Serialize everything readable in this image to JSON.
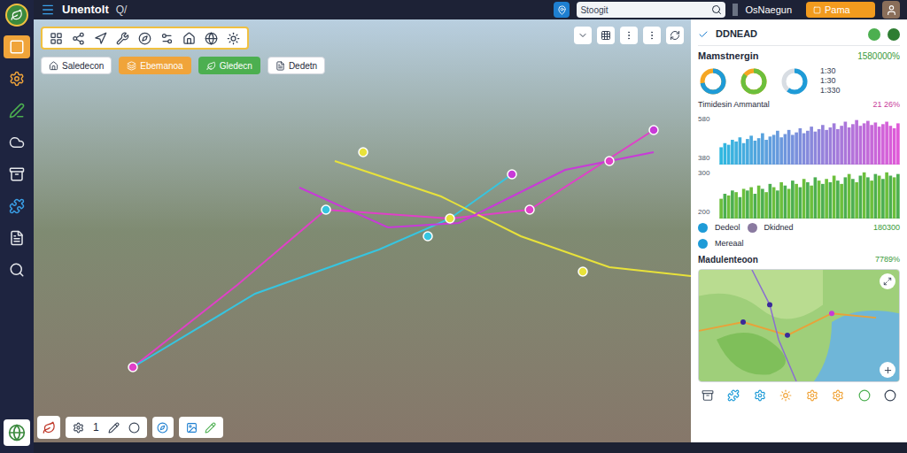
{
  "app": {
    "title": "Unentolt",
    "subtitle": "Q/"
  },
  "sidebar": {
    "items": [
      {
        "selected": true
      },
      {
        "selected": false
      },
      {
        "selected": false
      },
      {
        "selected": false
      },
      {
        "selected": false
      },
      {
        "selected": false
      },
      {
        "selected": false
      },
      {
        "selected": false
      }
    ]
  },
  "search": {
    "placeholder": "Stoogit"
  },
  "user": {
    "name": "OsNaegun"
  },
  "primary_button": {
    "label": "Pama"
  },
  "filters": [
    {
      "label": "Saledecon",
      "color": "#ffffff"
    },
    {
      "label": "Ebemanoa",
      "color": "#f0a43a"
    },
    {
      "label": "Gledecn",
      "color": "#4caf50"
    },
    {
      "label": "Dedetn",
      "color": "#ffffff"
    }
  ],
  "routes": [
    {
      "color": "#e040c8"
    },
    {
      "color": "#36c5e0"
    },
    {
      "color": "#e8e23a"
    },
    {
      "color": "#c83ad8"
    }
  ],
  "bottom_toolbar": {
    "page": "1"
  },
  "panel": {
    "title": "DDNEAD",
    "metric": {
      "label": "Mamstnergin",
      "value": "1580000%"
    },
    "donuts": [
      {
        "level": 0.72,
        "color": "#1e9bd7"
      },
      {
        "level": 0.85,
        "color": "#6cbf3c"
      },
      {
        "level": 0.6,
        "color": "#1e9bd7"
      }
    ],
    "readings": [
      "1:30",
      "1:30",
      "1:330"
    ],
    "chart1": {
      "title": "Timidesin Ammantal",
      "value": "21 26%",
      "ticks": [
        "580",
        "380"
      ],
      "max": 600,
      "values": [
        210,
        260,
        240,
        300,
        280,
        330,
        260,
        310,
        350,
        290,
        320,
        380,
        300,
        340,
        360,
        410,
        330,
        370,
        420,
        360,
        390,
        440,
        380,
        410,
        460,
        400,
        430,
        480,
        420,
        450,
        500,
        430,
        470,
        520,
        450,
        490,
        540,
        470,
        500,
        530,
        480,
        510,
        460,
        490,
        520,
        470,
        440,
        500
      ]
    },
    "chart2": {
      "ticks": [
        "300",
        "200"
      ],
      "max": 300,
      "values": [
        120,
        150,
        140,
        170,
        160,
        130,
        180,
        170,
        190,
        150,
        200,
        180,
        160,
        210,
        190,
        170,
        220,
        200,
        180,
        230,
        210,
        190,
        240,
        220,
        200,
        250,
        230,
        210,
        240,
        220,
        260,
        230,
        210,
        250,
        270,
        240,
        220,
        260,
        280,
        250,
        230,
        270,
        260,
        240,
        280,
        260,
        250,
        270
      ]
    },
    "rows": [
      {
        "label": "Dedeol",
        "secondary": "Dkidned",
        "value": "180300"
      },
      {
        "label": "Mereaal",
        "secondary": "",
        "value": ""
      }
    ],
    "map": {
      "title": "Madulenteoon",
      "value": "7789%"
    }
  }
}
